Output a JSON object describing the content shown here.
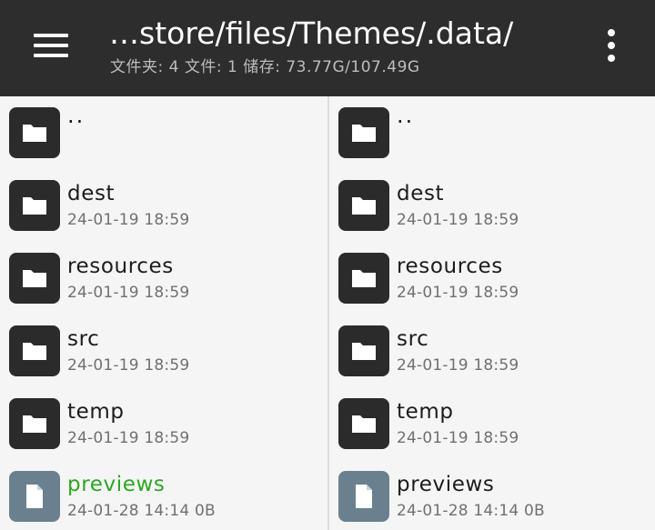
{
  "appbar": {
    "menu_icon": "hamburger-menu-icon",
    "path": "…store/files/Themes/.data/",
    "subtitle": "文件夹: 4  文件: 1  储存: 73.77G/107.49G",
    "more_icon": "more-vertical-icon"
  },
  "left_pane": {
    "items": [
      {
        "name": "..",
        "meta": "",
        "type": "folder"
      },
      {
        "name": "dest",
        "meta": "24-01-19 18:59",
        "type": "folder"
      },
      {
        "name": "resources",
        "meta": "24-01-19 18:59",
        "type": "folder"
      },
      {
        "name": "src",
        "meta": "24-01-19 18:59",
        "type": "folder"
      },
      {
        "name": "temp",
        "meta": "24-01-19 18:59",
        "type": "folder"
      },
      {
        "name": "previews",
        "meta": "24-01-28 14:14  0B",
        "type": "file",
        "highlight": true
      }
    ]
  },
  "right_pane": {
    "items": [
      {
        "name": "..",
        "meta": "",
        "type": "folder"
      },
      {
        "name": "dest",
        "meta": "24-01-19 18:59",
        "type": "folder"
      },
      {
        "name": "resources",
        "meta": "24-01-19 18:59",
        "type": "folder"
      },
      {
        "name": "src",
        "meta": "24-01-19 18:59",
        "type": "folder"
      },
      {
        "name": "temp",
        "meta": "24-01-19 18:59",
        "type": "folder"
      },
      {
        "name": "previews",
        "meta": "24-01-28 14:14  0B",
        "type": "file"
      }
    ]
  },
  "colors": {
    "appbar_bg": "#2d2d2d",
    "folder_icon_bg": "#2b2b2b",
    "file_icon_bg": "#6a808e",
    "highlight_text": "#2ea624"
  }
}
